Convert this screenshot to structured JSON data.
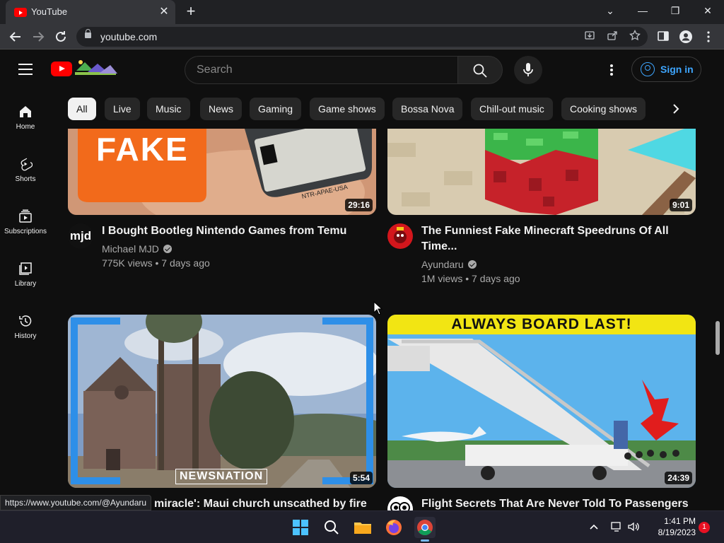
{
  "browser": {
    "tab_title": "YouTube",
    "tab_close": "✕",
    "new_tab": "+",
    "url": "youtube.com",
    "status_url": "https://www.youtube.com/@Ayundaru",
    "window_controls": {
      "chevron": "⌄",
      "minimize": "—",
      "restore": "❐",
      "close": "✕"
    }
  },
  "masthead": {
    "search_placeholder": "Search",
    "signin_label": "Sign in"
  },
  "chips": [
    "All",
    "Live",
    "Music",
    "News",
    "Gaming",
    "Game shows",
    "Bossa Nova",
    "Chill-out music",
    "Cooking shows"
  ],
  "sidebar": {
    "items": [
      {
        "label": "Home",
        "icon": "home-icon"
      },
      {
        "label": "Shorts",
        "icon": "shorts-icon"
      },
      {
        "label": "Subscriptions",
        "icon": "subscriptions-icon"
      },
      {
        "label": "Library",
        "icon": "library-icon"
      },
      {
        "label": "History",
        "icon": "history-icon"
      }
    ]
  },
  "videos": [
    {
      "title_line1": "I Bought Bootleg Nintendo Games from Temu",
      "title_line2": "",
      "channel": "Michael MJD",
      "meta": "775K views • 7 days ago",
      "duration": "29:16",
      "thumb_text": "FAKE",
      "cart_text": "NTR-APAE-USA",
      "avatar_text": "mjd"
    },
    {
      "title_line1": "The Funniest Fake Minecraft Speedruns Of All",
      "title_line2": "Time...",
      "channel": "Ayundaru",
      "meta": "1M views • 7 days ago",
      "duration": "9:01"
    },
    {
      "title_line1": "miracle': Maui church unscathed by fire",
      "channel": "",
      "meta": "",
      "duration": "5:54",
      "thumb_text": "NEWSNATION"
    },
    {
      "title_line1": "Flight Secrets That Are Never Told To Passengers",
      "channel": "",
      "meta": "",
      "duration": "24:39",
      "thumb_text": "ALWAYS BOARD LAST!"
    }
  ],
  "taskbar": {
    "time": "1:41 PM",
    "date": "8/19/2023",
    "notifications": "1"
  },
  "colors": {
    "accent": "#3ea6ff",
    "brand": "#ff0000"
  }
}
